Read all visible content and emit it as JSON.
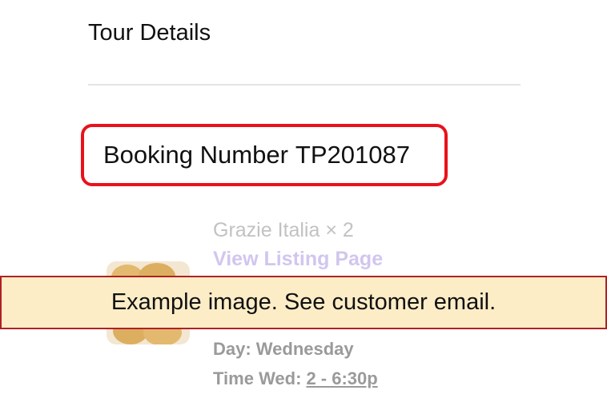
{
  "section": {
    "title": "Tour Details"
  },
  "booking": {
    "label": "Booking Number",
    "number": "TP201087"
  },
  "tour": {
    "name": "Grazie Italia × 2",
    "view_listing_link": "View Listing Page",
    "day": "Day: Wednesday",
    "time_label": "Time Wed:",
    "time_value": "2 - 6:30p"
  },
  "banner": {
    "text": "Example image. See customer email."
  },
  "colors": {
    "highlight_border": "#e8121c",
    "banner_background": "#fdedc7",
    "banner_border": "#b02025",
    "link": "#d2c6ef"
  }
}
